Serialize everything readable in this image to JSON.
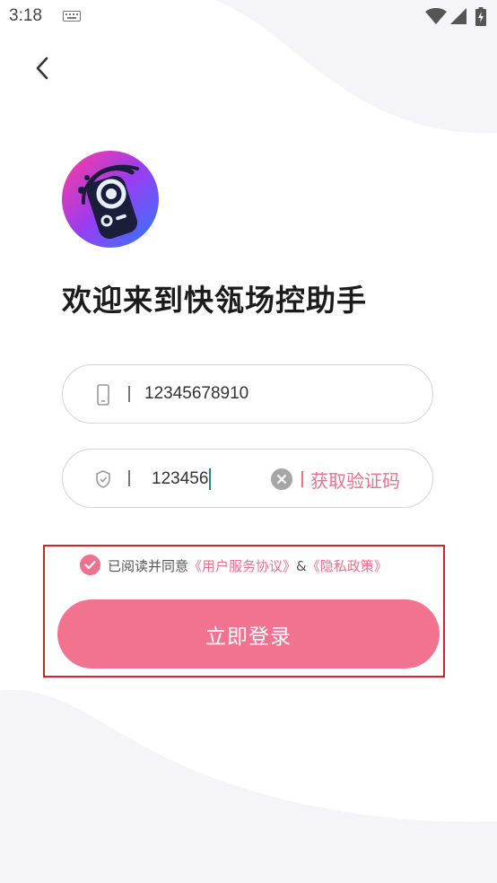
{
  "status_bar": {
    "time": "3:18"
  },
  "header": {
    "back_icon": "chevron-left-icon"
  },
  "welcome": {
    "title": "欢迎来到快瓴场控助手"
  },
  "phone_field": {
    "icon": "phone-icon",
    "value": "12345678910"
  },
  "code_field": {
    "icon": "shield-icon",
    "value": "123456",
    "clear_icon": "clear-icon",
    "get_code_label": "获取验证码"
  },
  "agreement": {
    "checked": true,
    "prefix": "已阅读并同意",
    "service_link": "《用户服务协议》",
    "amp": "&",
    "privacy_link": "《隐私政策》"
  },
  "login_button": {
    "label": "立即登录"
  },
  "colors": {
    "accent": "#f2738f",
    "link": "#ee6f8a",
    "highlight_border": "#d42525",
    "background_wave": "#f5f4f8"
  }
}
